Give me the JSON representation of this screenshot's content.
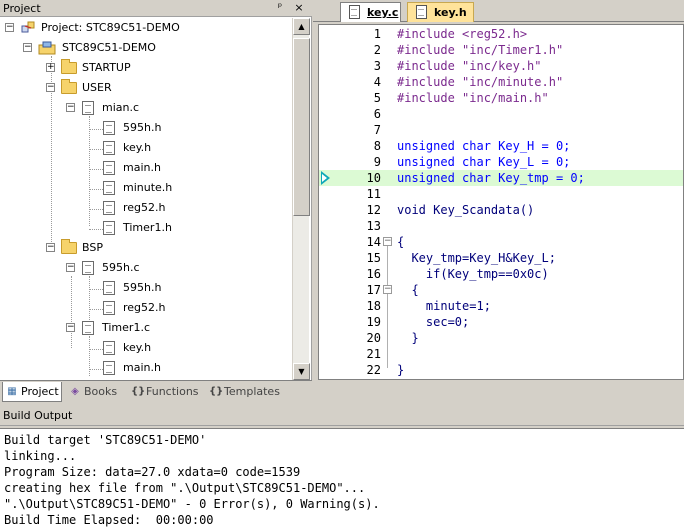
{
  "project_panel": {
    "title": "Project",
    "pin": "ᵖ",
    "close": "×",
    "tree": {
      "project": "Project: STC89C51-DEMO",
      "target": "STC89C51-DEMO",
      "groups": [
        {
          "label": "STARTUP",
          "expanded": false
        },
        {
          "label": "USER",
          "expanded": true,
          "files": [
            {
              "label": "mian.c",
              "expanded": true,
              "deps": [
                "595h.h",
                "key.h",
                "main.h",
                "minute.h",
                "reg52.h",
                "Timer1.h"
              ]
            }
          ]
        },
        {
          "label": "BSP",
          "expanded": true,
          "files": [
            {
              "label": "595h.c",
              "expanded": true,
              "deps": [
                "595h.h",
                "reg52.h"
              ]
            },
            {
              "label": "Timer1.c",
              "expanded": true,
              "deps": [
                "key.h",
                "main.h"
              ]
            }
          ]
        }
      ]
    },
    "tabs": [
      {
        "label": "Project",
        "icon": "project-icon",
        "active": true
      },
      {
        "label": "Books",
        "icon": "books-icon",
        "active": false
      },
      {
        "label": "Functions",
        "icon": "functions-icon",
        "active": false
      },
      {
        "label": "Templates",
        "icon": "templates-icon",
        "active": false
      }
    ]
  },
  "editor": {
    "tabs": [
      {
        "label": "key.c",
        "active": true
      },
      {
        "label": "key.h",
        "active": false
      }
    ],
    "current_line": 10,
    "lines": [
      {
        "n": "1",
        "text": "#include <reg52.h>"
      },
      {
        "n": "2",
        "text": "#include \"inc/Timer1.h\""
      },
      {
        "n": "3",
        "text": "#include \"inc/key.h\""
      },
      {
        "n": "4",
        "text": "#include \"inc/minute.h\""
      },
      {
        "n": "5",
        "text": "#include \"inc/main.h\""
      },
      {
        "n": "6",
        "text": ""
      },
      {
        "n": "7",
        "text": ""
      },
      {
        "n": "8",
        "text": "unsigned char Key_H = 0;"
      },
      {
        "n": "9",
        "text": "unsigned char Key_L = 0;"
      },
      {
        "n": "10",
        "text": "unsigned char Key_tmp = 0;"
      },
      {
        "n": "11",
        "text": ""
      },
      {
        "n": "12",
        "text": "void Key_Scandata()"
      },
      {
        "n": "13",
        "text": ""
      },
      {
        "n": "14",
        "text": "{"
      },
      {
        "n": "15",
        "text": "  Key_tmp=Key_H&Key_L;"
      },
      {
        "n": "16",
        "text": "    if(Key_tmp==0x0c)"
      },
      {
        "n": "17",
        "text": "  {"
      },
      {
        "n": "18",
        "text": "    minute=1;"
      },
      {
        "n": "19",
        "text": "    sec=0;"
      },
      {
        "n": "20",
        "text": "  }"
      },
      {
        "n": "21",
        "text": ""
      },
      {
        "n": "22",
        "text": "}"
      }
    ]
  },
  "build_output": {
    "title": "Build Output",
    "lines": [
      "Build target 'STC89C51-DEMO'",
      "linking...",
      "Program Size: data=27.0 xdata=0 code=1539",
      "creating hex file from \".\\Output\\STC89C51-DEMO\"...",
      "\".\\Output\\STC89C51-DEMO\" - 0 Error(s), 0 Warning(s).",
      "Build Time Elapsed:  00:00:00"
    ]
  }
}
